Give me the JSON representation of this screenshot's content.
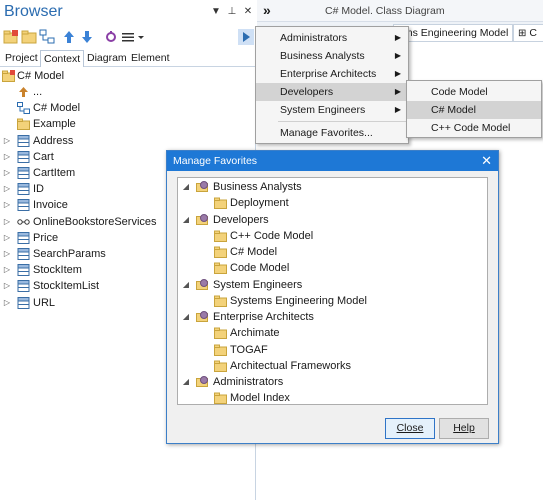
{
  "browser": {
    "title": "Browser",
    "header_buttons": [
      "▼",
      "⊥",
      "✕"
    ],
    "tabs": [
      "Project",
      "Context",
      "Diagram",
      "Element"
    ],
    "active_tab": "Context",
    "root": "C# Model",
    "items": [
      {
        "label": "...",
        "icon": "up-arrow-icon",
        "expander": false
      },
      {
        "label": "C# Model",
        "icon": "package-diagram-icon",
        "expander": false
      },
      {
        "label": "Example",
        "icon": "folder-icon",
        "expander": false
      },
      {
        "label": "Address",
        "icon": "class-icon",
        "expander": true
      },
      {
        "label": "Cart",
        "icon": "class-icon",
        "expander": true
      },
      {
        "label": "CartItem",
        "icon": "class-icon",
        "expander": true
      },
      {
        "label": "ID",
        "icon": "class-icon",
        "expander": true
      },
      {
        "label": "Invoice",
        "icon": "class-icon",
        "expander": true
      },
      {
        "label": "OnlineBookstoreServices",
        "icon": "interface-icon",
        "expander": true
      },
      {
        "label": "Price",
        "icon": "class-icon",
        "expander": true
      },
      {
        "label": "SearchParams",
        "icon": "class-icon",
        "expander": true
      },
      {
        "label": "StockItem",
        "icon": "class-icon",
        "expander": true
      },
      {
        "label": "StockItemList",
        "icon": "class-icon",
        "expander": true
      },
      {
        "label": "URL",
        "icon": "class-icon",
        "expander": true
      }
    ]
  },
  "header": {
    "chevrons": "»",
    "breadcrumb": "C# Model.  Class Diagram"
  },
  "diagram_tabs": {
    "tab1": "ems Engineering Model",
    "tab2": "C"
  },
  "favorites_menu": {
    "items": [
      {
        "label": "Administrators",
        "submenu": true
      },
      {
        "label": "Business Analysts",
        "submenu": true
      },
      {
        "label": "Enterprise Architects",
        "submenu": true
      },
      {
        "label": "Developers",
        "submenu": true
      },
      {
        "label": "System Engineers",
        "submenu": true
      },
      {
        "label": "Manage Favorites...",
        "submenu": false
      }
    ],
    "selected": "Developers"
  },
  "developers_submenu": {
    "items": [
      "Code Model",
      "C# Model",
      "C++ Code Model"
    ],
    "selected": "C# Model"
  },
  "dialog": {
    "title": "Manage Favorites",
    "close_glyph": "✕",
    "groups": [
      {
        "label": "Business Analysts",
        "children": [
          "Deployment"
        ]
      },
      {
        "label": "Developers",
        "children": [
          "C++ Code Model",
          "C# Model",
          "Code Model"
        ]
      },
      {
        "label": "System Engineers",
        "children": [
          "Systems Engineering Model"
        ]
      },
      {
        "label": "Enterprise Architects",
        "children": [
          "Archimate",
          "TOGAF",
          "Architectual Frameworks"
        ]
      },
      {
        "label": "Administrators",
        "children": [
          "Model Index"
        ]
      }
    ],
    "close_button": "Close",
    "help_button": "Help"
  },
  "colors": {
    "accent": "#1e78d6",
    "title_blue": "#2b6cb0",
    "menu_highlight": "#d3d3d3"
  }
}
